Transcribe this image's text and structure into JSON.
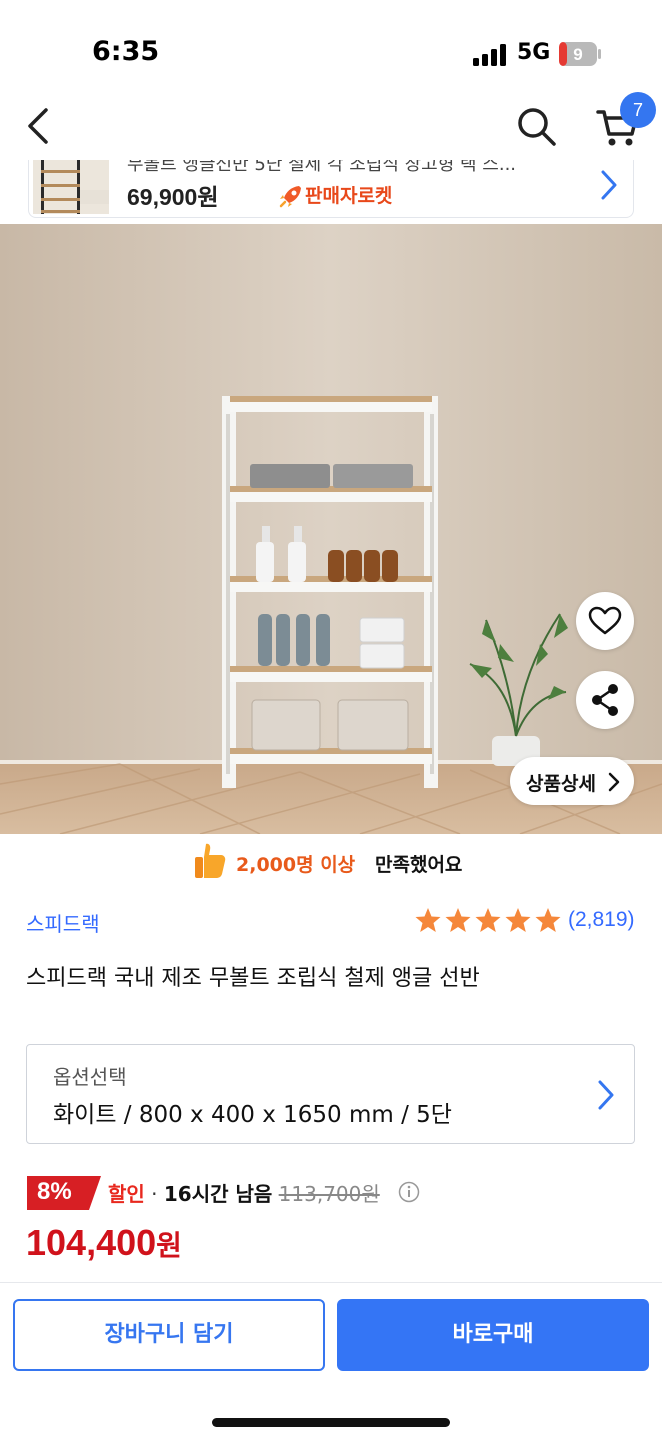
{
  "status_bar": {
    "time": "6:35",
    "network": "5G",
    "battery": "9"
  },
  "nav": {
    "cart_count": "7"
  },
  "related_product": {
    "title": "무볼트 앵글선반 5단 철제 각 조립식 창고형 랙 스...",
    "price": "69,900원",
    "seller_badge": "판매자로켓"
  },
  "photo": {
    "detail_button": "상품상세"
  },
  "satisfaction": {
    "highlight": "2,000명 이상",
    "rest": "만족했어요"
  },
  "product": {
    "brand": "스피드랙",
    "rating": 5,
    "review_count": "(2,819)",
    "title": "스피드랙 국내 제조 무볼트 조립식 철제 앵글 선반"
  },
  "option": {
    "label": "옵션선택",
    "value": "화이트 / 800 x 400 x 1650 mm / 5단"
  },
  "price": {
    "discount_rate": "8%",
    "sale_label": "할인",
    "separator": "·",
    "time_left": "16시간 남음",
    "original": "113,700원",
    "final_number": "104,400",
    "final_unit": "원"
  },
  "actions": {
    "add_to_cart": "장바구니 담기",
    "buy_now": "바로구매"
  },
  "colors": {
    "accent": "#346aff",
    "price_red": "#d0121b",
    "discount_red": "#e8281e",
    "badge_orange": "#e85a1b",
    "star": "#f5873a"
  }
}
